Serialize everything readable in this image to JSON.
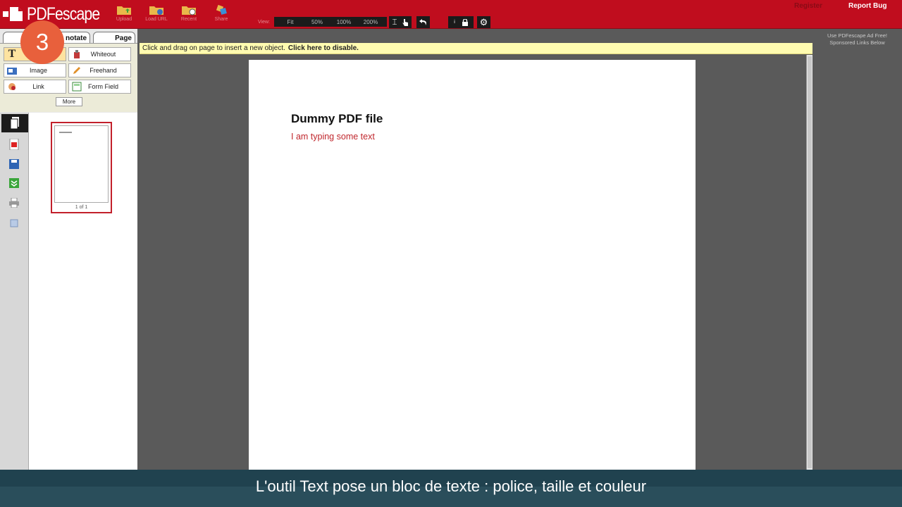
{
  "app": {
    "logo_text": "PDFescape"
  },
  "toolbar": {
    "buttons": [
      {
        "label": "Upload",
        "icon": "folder-upload-icon"
      },
      {
        "label": "Load URL",
        "icon": "folder-url-icon"
      },
      {
        "label": "Recent",
        "icon": "folder-recent-icon"
      },
      {
        "label": "Share",
        "icon": "share-icon"
      }
    ],
    "zoom_label": "View:",
    "zoom_options": [
      "Fit",
      "50%",
      "100%",
      "200%"
    ],
    "register_label": "Register",
    "report_bug_label": "Report Bug"
  },
  "tabs": {
    "annotate": "notate",
    "page": "Page"
  },
  "step_badge": "3",
  "tools": [
    {
      "label": "Text",
      "icon": "text-tool-icon"
    },
    {
      "label": "Whiteout",
      "icon": "whiteout-icon"
    },
    {
      "label": "Image",
      "icon": "image-icon"
    },
    {
      "label": "Freehand",
      "icon": "pencil-icon"
    },
    {
      "label": "Link",
      "icon": "link-icon"
    },
    {
      "label": "Form Field",
      "icon": "form-field-icon"
    }
  ],
  "more_label": "More",
  "thumbnail": {
    "page_label": "1 of 1"
  },
  "notice": {
    "text": "Click and drag on page to insert a new object.",
    "link": "Click here to disable."
  },
  "document": {
    "title": "Dummy PDF file",
    "typed_text": "I am typing some text"
  },
  "ad": {
    "line1": "Use PDFescape Ad Free!",
    "line2": "Sponsored Links Below"
  },
  "caption": "L'outil Text pose un bloc de texte : police, taille et couleur",
  "colors": {
    "brand_red": "#c00d1e",
    "typed_text": "#c0272d",
    "badge": "#e8603c",
    "caption_bg": "#20424f"
  }
}
